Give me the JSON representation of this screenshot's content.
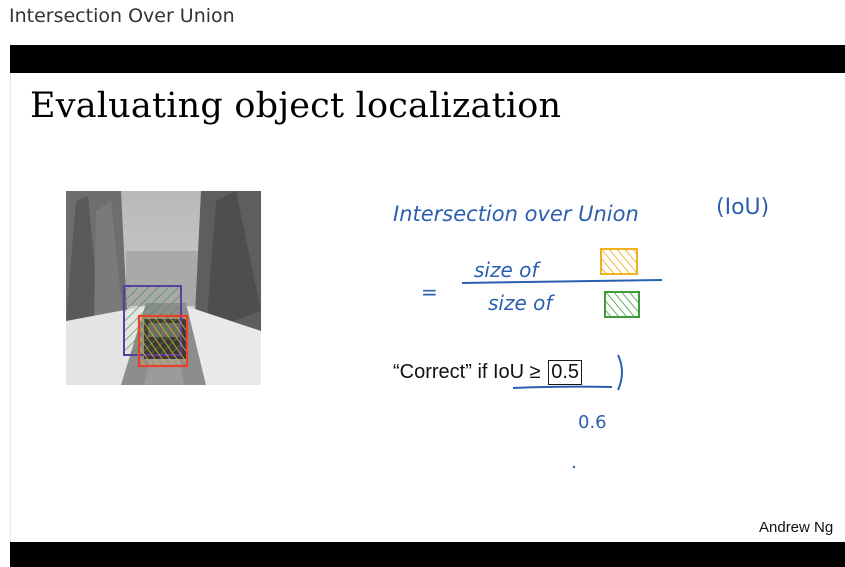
{
  "header": {
    "title": "Intersection Over Union"
  },
  "slide": {
    "title": "Evaluating object localization",
    "author": "Andrew Ng",
    "criterion": {
      "label": "“Correct” if IoU ≥",
      "value": "0.5"
    }
  },
  "annotations": {
    "definition": "Intersection over Union",
    "abbrev": "(IoU)",
    "equals": "=",
    "numerator": "size of",
    "denominator": "size of",
    "alt_threshold": "0.6"
  },
  "colors": {
    "ink_blue": "#2b5fb0",
    "box_purple": "#5a3fa0",
    "box_red": "#e8402a",
    "swatch_yellow": "#f0b020",
    "swatch_green": "#3f9a3a"
  },
  "icons": {
    "numerator_swatch": "hatched-yellow-square",
    "denominator_swatch": "hatched-green-square"
  }
}
